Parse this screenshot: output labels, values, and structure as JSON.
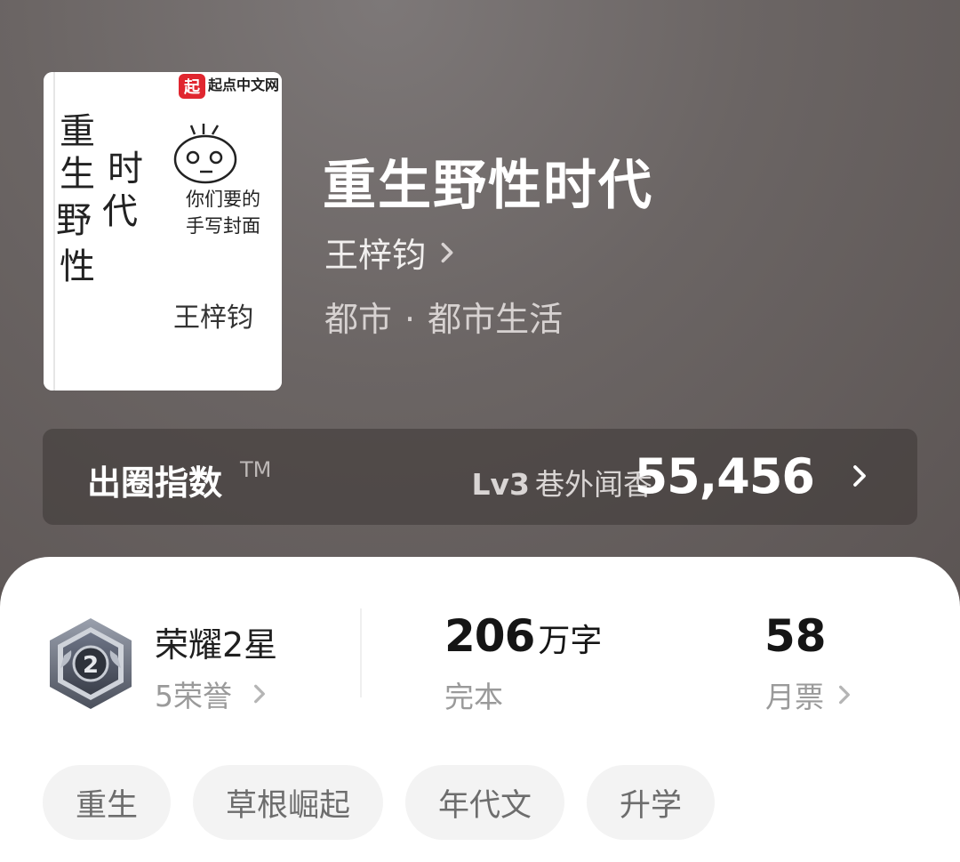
{
  "cover": {
    "publisher_logo_text": "起点中文网",
    "handwritten_title": "重生野性时代",
    "handwritten_note": "你们要的手写封面",
    "handwritten_author": "王梓钧"
  },
  "book": {
    "title": "重生野性时代",
    "author": "王梓钧",
    "category_main": "都市",
    "category_separator": "·",
    "category_sub": "都市生活"
  },
  "index": {
    "label": "出圈指数",
    "tm": "TM",
    "level": "Lv3",
    "level_name": "巷外闻香",
    "value": "55,456"
  },
  "stats": {
    "honor_title": "荣耀2星",
    "honor_count": "5荣誉",
    "badge_number": "2",
    "word_count": "206",
    "word_unit": "万字",
    "status": "完本",
    "monthly_votes": "58",
    "monthly_votes_label": "月票"
  },
  "tags": [
    "重生",
    "草根崛起",
    "年代文",
    "升学"
  ],
  "colors": {
    "header_bg": "#6b6564",
    "card_bg": "#ffffff",
    "tag_bg": "#f3f3f3",
    "badge_metal": "#5d6478"
  }
}
